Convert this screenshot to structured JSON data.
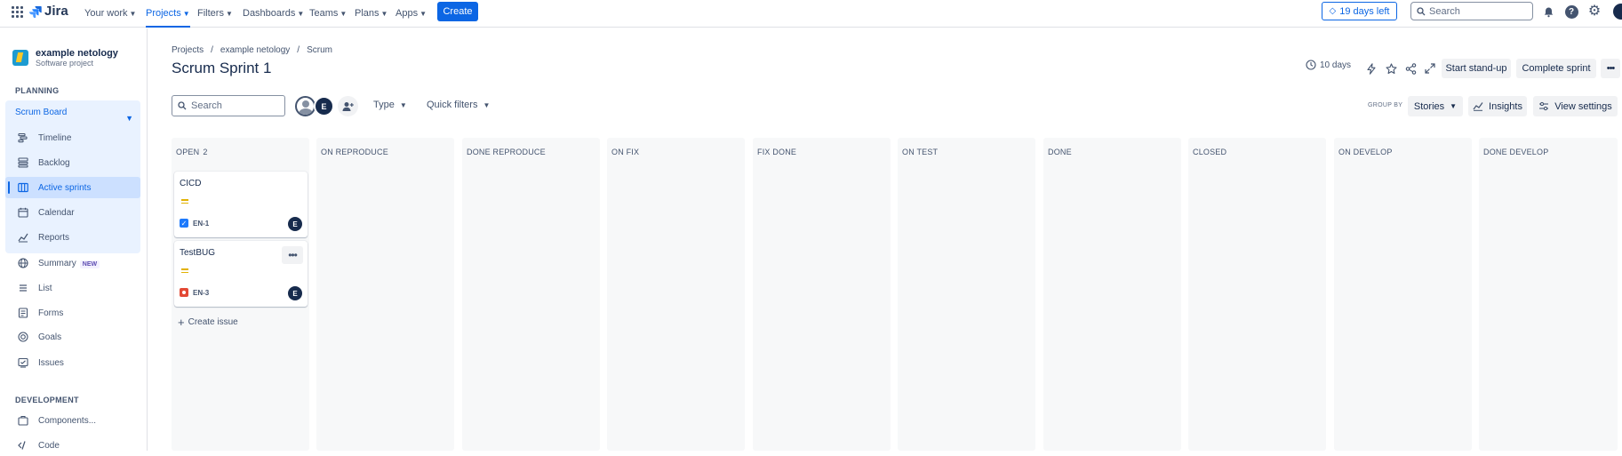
{
  "topnav": {
    "logo_text": "Jira",
    "items": [
      {
        "label": "Your work"
      },
      {
        "label": "Projects"
      },
      {
        "label": "Filters"
      },
      {
        "label": "Dashboards"
      },
      {
        "label": "Teams"
      },
      {
        "label": "Plans"
      },
      {
        "label": "Apps"
      }
    ],
    "create_label": "Create",
    "trial_label": "19 days left",
    "search_placeholder": "Search",
    "profile_initial": ""
  },
  "sidebar": {
    "project_name": "example netology",
    "project_type": "Software project",
    "planning_title": "PLANNING",
    "board_label": "Scrum Board",
    "board_items": [
      {
        "label": "Timeline",
        "icon": "timeline-icon"
      },
      {
        "label": "Backlog",
        "icon": "backlog-icon"
      },
      {
        "label": "Active sprints",
        "icon": "board-icon"
      },
      {
        "label": "Calendar",
        "icon": "calendar-icon"
      },
      {
        "label": "Reports",
        "icon": "reports-icon"
      }
    ],
    "other_items": [
      {
        "label": "Summary",
        "icon": "globe-icon",
        "badge": "NEW"
      },
      {
        "label": "List",
        "icon": "list-icon"
      },
      {
        "label": "Forms",
        "icon": "forms-icon"
      },
      {
        "label": "Goals",
        "icon": "goals-icon"
      },
      {
        "label": "Issues",
        "icon": "issues-icon"
      }
    ],
    "development_title": "DEVELOPMENT",
    "dev_items": [
      {
        "label": "Components...",
        "icon": "components-icon"
      },
      {
        "label": "Code",
        "icon": "code-icon"
      }
    ]
  },
  "breadcrumb": [
    "Projects",
    "example netology",
    "Scrum"
  ],
  "page_title": "Scrum Sprint 1",
  "header": {
    "days_label": "10 days",
    "standup_label": "Start stand-up",
    "complete_label": "Complete sprint"
  },
  "toolbar": {
    "search_placeholder": "Search",
    "avatar_initial": "E",
    "type_label": "Type",
    "quick_filters_label": "Quick filters",
    "group_by_label": "GROUP BY",
    "group_by_value": "Stories",
    "insights_label": "Insights",
    "view_settings_label": "View settings"
  },
  "columns": [
    {
      "title": "OPEN",
      "count": "2"
    },
    {
      "title": "ON REPRODUCE",
      "count": ""
    },
    {
      "title": "DONE REPRODUCE",
      "count": ""
    },
    {
      "title": "ON FIX",
      "count": ""
    },
    {
      "title": "FIX DONE",
      "count": ""
    },
    {
      "title": "ON TEST",
      "count": ""
    },
    {
      "title": "DONE",
      "count": ""
    },
    {
      "title": "CLOSED",
      "count": ""
    },
    {
      "title": "ON DEVELOP",
      "count": ""
    },
    {
      "title": "DONE DEVELOP",
      "count": ""
    }
  ],
  "cards": [
    {
      "title": "CICD",
      "key": "EN-1",
      "type": "story",
      "assignee": "E",
      "priority": "medium"
    },
    {
      "title": "TestBUG",
      "key": "EN-3",
      "type": "bug",
      "assignee": "E",
      "priority": "medium"
    }
  ],
  "create_issue_label": "Create issue",
  "colors": {
    "accent": "#0C66E4",
    "selected_bg": "#CCE0FF",
    "column_bg": "#F7F8F9",
    "priority": "#E2B203",
    "bug": "#E34935"
  }
}
